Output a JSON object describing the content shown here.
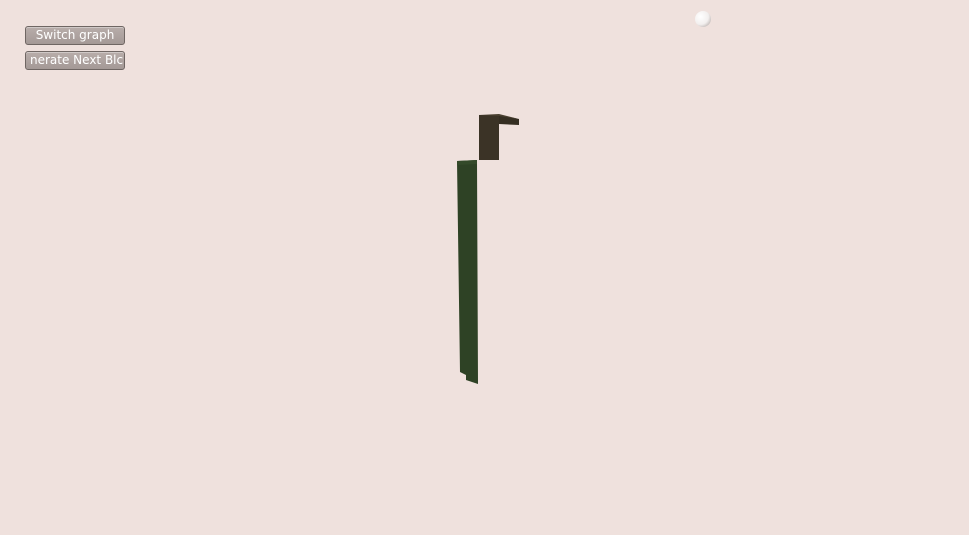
{
  "controls": {
    "switch_graph_label": "Switch graph",
    "generate_next_block_label": "nerate Next Blc"
  },
  "scene": {
    "background_color": "#efe1dd",
    "block_color_dark": "#3b3326",
    "block_color_green": "#2e4225",
    "light_marker": "light-sphere-icon"
  }
}
